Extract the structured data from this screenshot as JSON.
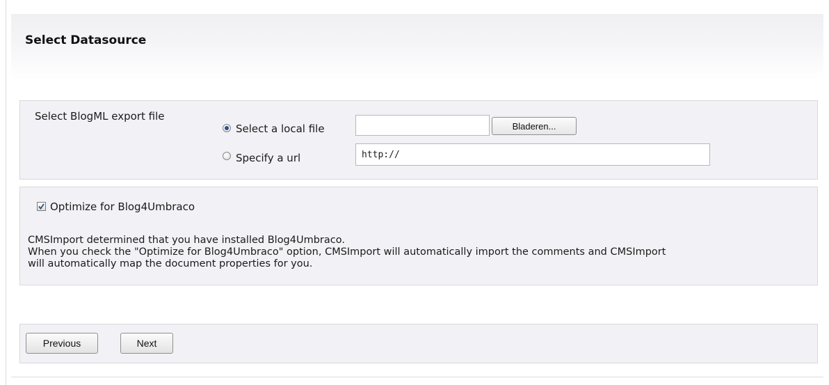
{
  "page": {
    "title": "Select Datasource"
  },
  "datasource": {
    "label": "Select BlogML export file",
    "local_option_label": "Select a local file",
    "local_selected": true,
    "file_value": "",
    "browse_label": "Bladeren...",
    "url_option_label": "Specify a url",
    "url_value": "http://"
  },
  "optimize": {
    "checkbox_label": "Optimize for Blog4Umbraco",
    "checked": true,
    "info_lines": [
      "CMSImport determined that you have installed Blog4Umbraco.",
      "When you check the \"Optimize for Blog4Umbraco\" option, CMSImport will automatically import the comments and CMSImport",
      "will automatically map the document properties for you."
    ]
  },
  "nav": {
    "previous_label": "Previous",
    "next_label": "Next"
  },
  "colors": {
    "panel_background": "#f2f2f6",
    "panel_border": "#d8d8dc",
    "radio_dot": "#2b4f8a",
    "checkmark": "#2b4f8a"
  },
  "icons": {
    "radio_checked": "radio-checked-icon",
    "radio_unchecked": "radio-unchecked-icon",
    "checkbox_checked": "checkmark-icon"
  }
}
